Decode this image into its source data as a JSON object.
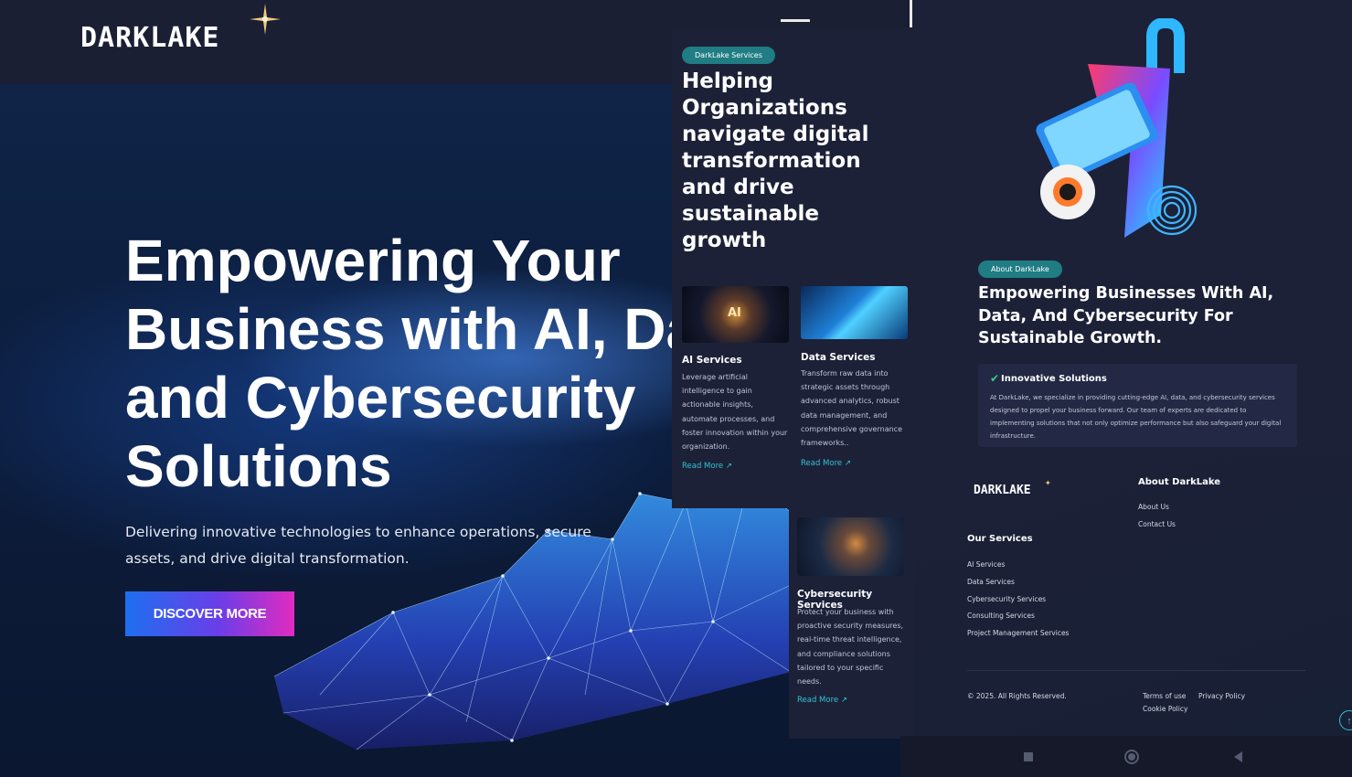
{
  "hero": {
    "logo": "DARKLAKE",
    "title": "Empowering Your\nBusiness with AI, Data\nand Cybersecurity\nSolutions",
    "subtitle": "Delivering innovative technologies to enhance operations, secure assets, and drive digital transformation.",
    "cta": "DISCOVER MORE"
  },
  "services": {
    "badge": "DarkLake Services",
    "heading": "Helping Organizations navigate digital transformation and drive sustainable growth",
    "cards": [
      {
        "title": "AI Services",
        "image_text": "AI",
        "description": "Leverage artificial intelligence to gain actionable insights, automate processes, and foster innovation within your organization.",
        "link": "Read More ↗"
      },
      {
        "title": "Data Services",
        "description": "Transform raw data into strategic assets through advanced analytics, robust data management, and comprehensive governance frameworks..",
        "link": "Read More ↗"
      },
      {
        "title": "Cybersecurity Services",
        "description": "Protect your business with proactive security measures, real-time threat intelligence, and compliance solutions tailored to your specific needs.",
        "link": "Read More ↗"
      }
    ]
  },
  "about": {
    "badge": "About DarkLake",
    "title": "Empowering Businesses With AI, Data, And Cybersecurity For Sustainable Growth.",
    "feature_title": "Innovative Solutions",
    "feature_text": "At DarkLake, we specialize in providing cutting-edge AI, data, and cybersecurity services designed to propel your business forward. Our team of experts are dedicated to implementing solutions that not only optimize performance but also safeguard your digital infrastructure."
  },
  "footer": {
    "logo": "DARKLAKE",
    "about_heading": "About DarkLake",
    "about_links": [
      "About Us",
      "Contact Us"
    ],
    "services_heading": "Our Services",
    "service_links": [
      "AI Services",
      "Data Services",
      "Cybersecurity Services",
      "Consulting Services",
      "Project Management Services"
    ],
    "copyright": "© 2025. All Rights Reserved.",
    "legal_links": [
      "Terms of use",
      "Privacy Policy",
      "Cookie Policy"
    ]
  },
  "colors": {
    "accent_teal": "#1f7d83",
    "link_cyan": "#35c2d2",
    "panel_bg": "#1c2138",
    "cta_gradient": [
      "#1d6ff0",
      "#6a3ee8",
      "#e12bc0"
    ]
  },
  "icons": [
    "menu-icon",
    "star-sparkle-icon",
    "external-arrow-icon",
    "check-icon",
    "arrow-up-icon",
    "square-nav-icon",
    "circle-nav-icon",
    "back-triangle-icon"
  ]
}
